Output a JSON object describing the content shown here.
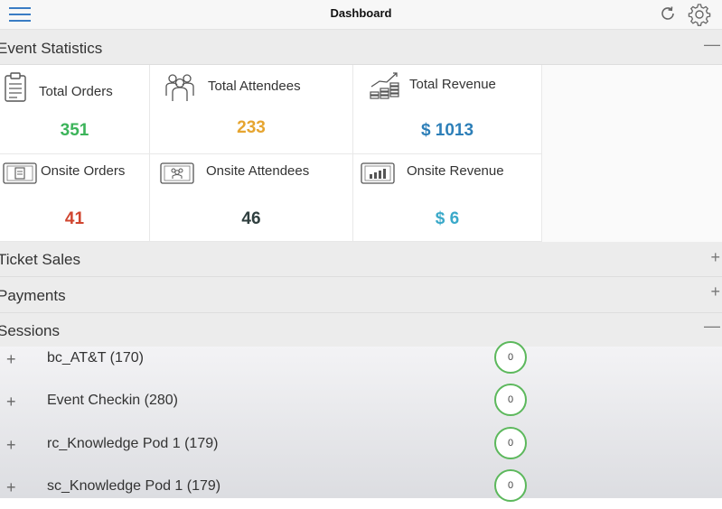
{
  "header": {
    "title": "Dashboard"
  },
  "sections": {
    "event_statistics": {
      "label": "Event Statistics",
      "toggle": "—"
    },
    "ticket_sales": {
      "label": "Ticket Sales",
      "toggle": "+"
    },
    "payments": {
      "label": "Payments",
      "toggle": "+"
    },
    "sessions": {
      "label": "Sessions",
      "toggle": "—"
    }
  },
  "stats": {
    "total_orders": {
      "label": "Total Orders",
      "value": "351",
      "color": "#3cb45a"
    },
    "total_attendees": {
      "label": "Total Attendees",
      "value": "233",
      "color": "#e6a530"
    },
    "total_revenue": {
      "label": "Total Revenue",
      "value": "$ 1013",
      "color": "#2d7fb8"
    },
    "onsite_orders": {
      "label": "Onsite Orders",
      "value": "41",
      "color": "#d0452f"
    },
    "onsite_attendees": {
      "label": "Onsite Attendees",
      "value": "46",
      "color": "#2f3f3f"
    },
    "onsite_revenue": {
      "label": "Onsite Revenue",
      "value": "$ 6",
      "color": "#3aa9c9"
    }
  },
  "session_list": [
    {
      "expand": "+",
      "name": "bc_AT&T (170)",
      "count": "0"
    },
    {
      "expand": "+",
      "name": "Event Checkin (280)",
      "count": "0"
    },
    {
      "expand": "+",
      "name": "rc_Knowledge Pod 1 (179)",
      "count": "0"
    },
    {
      "expand": "+",
      "name": "sc_Knowledge Pod 1 (179)",
      "count": "0"
    }
  ],
  "icons": {
    "menu": "hamburger-menu-icon",
    "refresh": "refresh-icon",
    "settings": "gear-icon",
    "total_orders": "clipboard-icon",
    "total_attendees": "people-group-icon",
    "total_revenue": "coins-chart-icon",
    "onsite_orders": "tablet-clipboard-icon",
    "onsite_attendees": "tablet-people-icon",
    "onsite_revenue": "tablet-chart-icon"
  }
}
